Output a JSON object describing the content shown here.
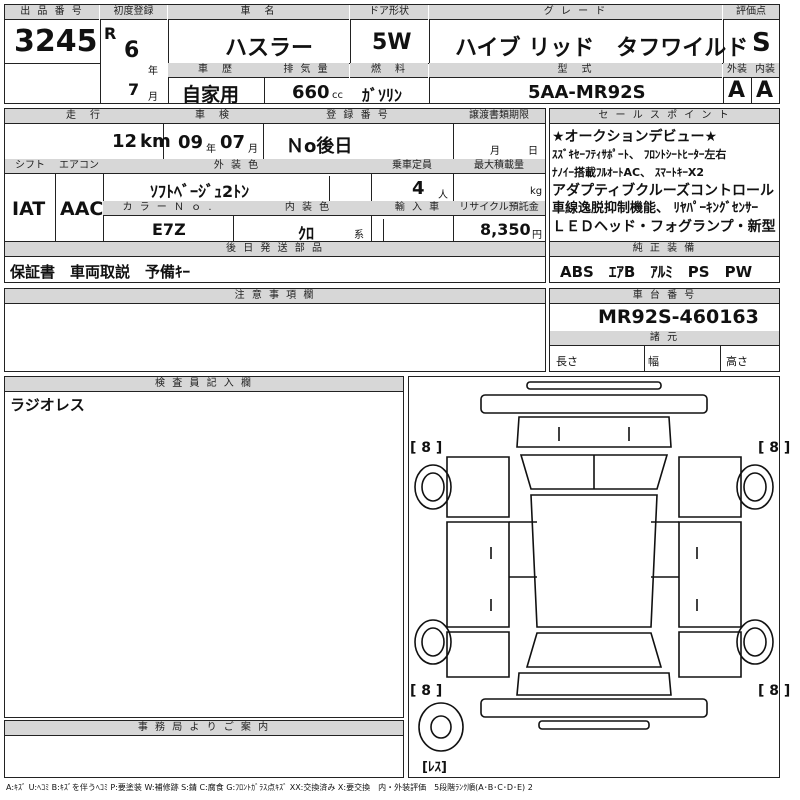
{
  "header": {
    "lot_no_label": "出 品 番 号",
    "lot_no": "3245",
    "first_reg_label": "初度登録",
    "era": "R",
    "year": "6",
    "year_unit": "年",
    "month": "7",
    "month_unit": "月",
    "car_name_label": "車　名",
    "car_name": "ハスラー",
    "door_label": "ドア形状",
    "door": "5W",
    "grade_label": "グ レ ー ド",
    "grade": "ハイブ リッド　タフワイルド",
    "score_label": "評価点",
    "score": "S",
    "history_label": "車　歴",
    "history": "自家用",
    "displacement_label": "排 気 量",
    "displacement": "660",
    "displacement_unit": "cc",
    "fuel_label": "燃　料",
    "fuel": "ｶﾞｿﾘﾝ",
    "model_label": "型　式",
    "model": "5AA-MR92S",
    "ext_label": "外装",
    "ext_score": "A",
    "int_label": "内装",
    "int_score": "A"
  },
  "row2": {
    "mileage_label": "走　行",
    "mileage": "12",
    "mileage_unit": "km",
    "inspection_label": "車　検",
    "insp_year": "09",
    "insp_year_unit": "年",
    "insp_month": "07",
    "insp_month_unit": "月",
    "plate_label": "登 録 番 号",
    "plate": "Ｎo後日",
    "transfer_label": "譲渡書類期限",
    "transfer_month_unit": "月",
    "transfer_day_unit": "日",
    "shift_label": "シフト",
    "shift": "IAT",
    "ac_label": "エアコン",
    "ac": "AAC",
    "ext_color_label": "外 装 色",
    "ext_color": "ｿﾌﾄﾍﾞｰｼﾞｭ2ﾄﾝ",
    "capacity_label": "乗車定員",
    "capacity": "4",
    "capacity_unit": "人",
    "load_label": "最大積載量",
    "load_unit": "kg",
    "color_no_label": "カ ラ ー Ｎ ｏ .",
    "color_no": "E7Z",
    "int_color_label": "内 装 色",
    "int_color": "ｸﾛ",
    "int_color_unit": "系",
    "import_label": "輸 入 車",
    "recycle_label": "リサイクル預託金",
    "recycle": "8,350",
    "recycle_unit": "円"
  },
  "sales": {
    "label": "セ ー ル ス ポ イ ン ト",
    "lines": [
      "★オークションデビュー★",
      "ｽｽﾞｷｾｰﾌﾃｨｻﾎﾟｰﾄ、 ﾌﾛﾝﾄｼｰﾄﾋｰﾀｰ左右",
      "ﾅﾉｲｰ搭載ﾌﾙｵｰﾄAC、 ｽﾏｰﾄｷｰX2",
      "アダプティブクルーズコントロール",
      "車線逸脱抑制機能、 ﾘﾔﾊﾟｰｷﾝｸﾞｾﾝｻｰ",
      "ＬＥＤヘッド・フォグランプ・新型"
    ]
  },
  "accessories": {
    "label": "後 日 発 送 部 品",
    "value": "保証書　車両取説　予備ｷｰ"
  },
  "equipment": {
    "label": "純 正 装 備",
    "value": "ABS　ｴｱB　ｱﾙﾐ　PS　PW"
  },
  "notes": {
    "label": "注 意 事 項 欄",
    "value": ""
  },
  "chassis": {
    "label": "車 台 番 号",
    "value": "MR92S-460163",
    "specs_label": "諸 元",
    "length_label": "長さ",
    "width_label": "幅",
    "height_label": "高さ"
  },
  "inspector": {
    "label": "検 査 員 記 入 欄",
    "value": "ラジオレス"
  },
  "office": {
    "label": "事 務 局 よ り ご 案 内",
    "value": ""
  },
  "diagram": {
    "tire_marks": [
      "[ 8 ]",
      "[ 8 ]",
      "[ 8 ]",
      "[ 8 ]"
    ],
    "spare_mark": "[ﾚｽ]"
  },
  "legend": "A:ｷｽﾞ U:ﾍｺﾐ B:ｷｽﾞを伴うﾍｺﾐ P:要塗装 W:補修跡 S:錆 C:腐食 G:ﾌﾛﾝﾄｶﾞﾗｽ点ｷｽﾞ XX:交換済み X:要交換　内・外装評価　5段階ﾗﾝｸ順(A･B･C･D･E) 2"
}
